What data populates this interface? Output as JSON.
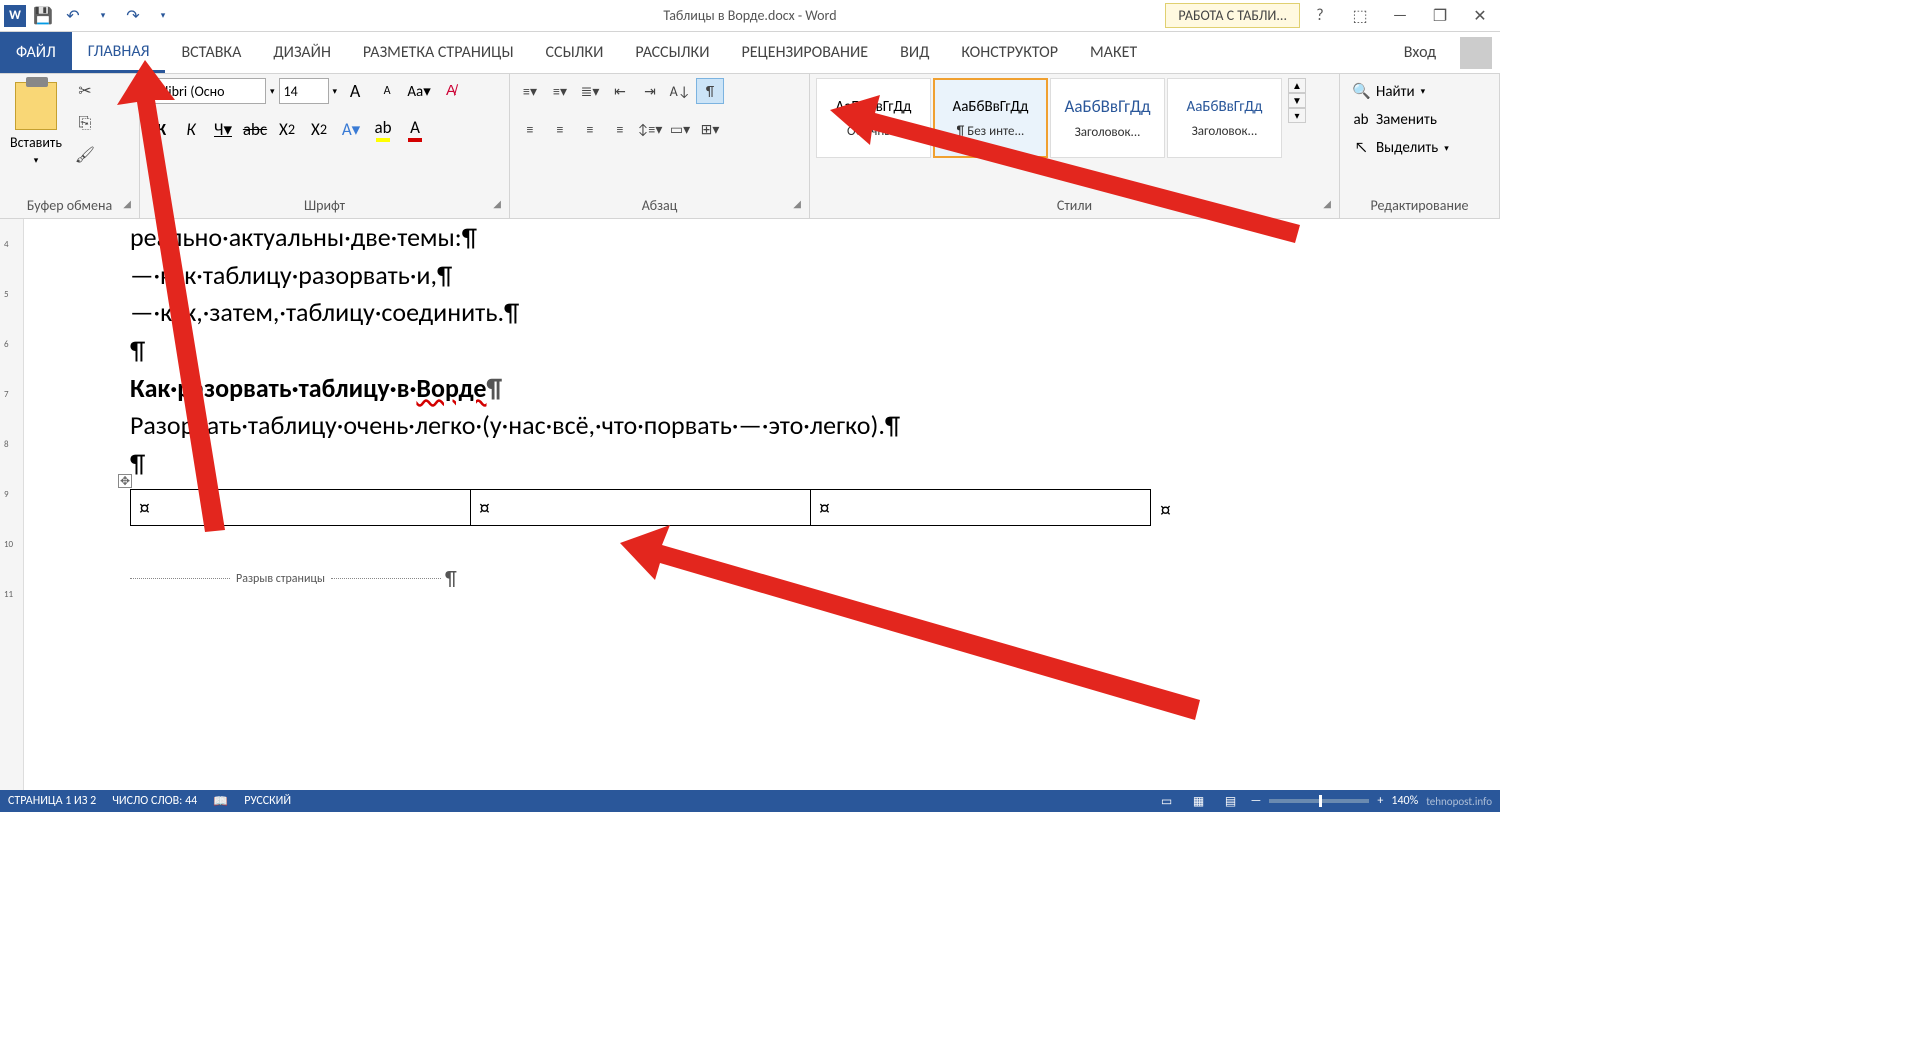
{
  "titlebar": {
    "doc_title": "Таблицы в Ворде.docx - Word",
    "table_tools": "РАБОТА С ТАБЛИ..."
  },
  "tabs": {
    "file": "ФАЙЛ",
    "home": "ГЛАВНАЯ",
    "insert": "ВСТАВКА",
    "design": "ДИЗАЙН",
    "layout": "РАЗМЕТКА СТРАНИЦЫ",
    "references": "ССЫЛКИ",
    "mailings": "РАССЫЛКИ",
    "review": "РЕЦЕНЗИРОВАНИЕ",
    "view": "ВИД",
    "ctx_design": "КОНСТРУКТОР",
    "ctx_layout": "МАКЕТ",
    "signin": "Вход"
  },
  "ribbon": {
    "clipboard": {
      "paste": "Вставить",
      "group": "Буфер обмена"
    },
    "font": {
      "name": "Calibri (Осно",
      "size": "14",
      "group": "Шрифт"
    },
    "paragraph": {
      "group": "Абзац"
    },
    "styles": {
      "group": "Стили",
      "sample": "АаБбВвГгДд",
      "items": [
        {
          "name": "Обычный"
        },
        {
          "name": "¶ Без инте..."
        },
        {
          "name": "Заголовок..."
        },
        {
          "name": "Заголовок..."
        }
      ]
    },
    "editing": {
      "group": "Редактирование",
      "find": "Найти",
      "replace": "Заменить",
      "select": "Выделить"
    }
  },
  "document": {
    "line1": "реально·актуальны·две·темы:¶",
    "line2": "—·как·таблицу·разорвать·и,¶",
    "line3": "—·как,·затем,·таблицу·соединить.¶",
    "line4": "¶",
    "line5a": "Как·разорвать·таблицу·в·",
    "line5b": "Ворде",
    "line5c": "¶",
    "line6": "Разорвать·таблицу·очень·легко·(у·нас·всё,·что·порвать·—·это·легко).¶",
    "line7": "¶",
    "cell_mark": "¤",
    "page_break": "Разрыв страницы",
    "pb_pil": "¶"
  },
  "statusbar": {
    "page": "СТРАНИЦА 1 ИЗ 2",
    "words": "ЧИСЛО СЛОВ: 44",
    "lang": "РУССКИЙ",
    "zoom": "140%",
    "watermark": "tehnopost.info"
  }
}
